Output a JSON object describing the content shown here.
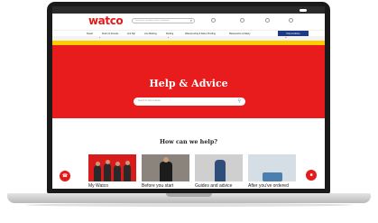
{
  "colors": {
    "brand_red": "#e31b1b",
    "nav_help_blue": "#1d3a84",
    "notice_yellow": "#ffcc00",
    "bezel": "#1a1a1a"
  },
  "header": {
    "logo": "watco",
    "search_placeholder": "Search for a product name or keyword"
  },
  "nav": {
    "items": [
      "Repair",
      "Floors & Screeds",
      "Anti Slip",
      "Line Marking",
      "Roofing",
      "Waterproofing & Damp Proofing",
      "Maintenance & Safety"
    ],
    "help_label": "Help & Advice"
  },
  "hero": {
    "title": "Help & Advice",
    "search_placeholder": "Search for help & advice"
  },
  "content": {
    "title": "How can we help?",
    "cards": [
      {
        "label": "My Watco"
      },
      {
        "label": "Before you start"
      },
      {
        "label": "Guides and advice"
      },
      {
        "label": "After you've ordered"
      }
    ]
  },
  "icons": {
    "search": "search-icon",
    "phone": "phone-icon",
    "chat": "chat-icon"
  }
}
